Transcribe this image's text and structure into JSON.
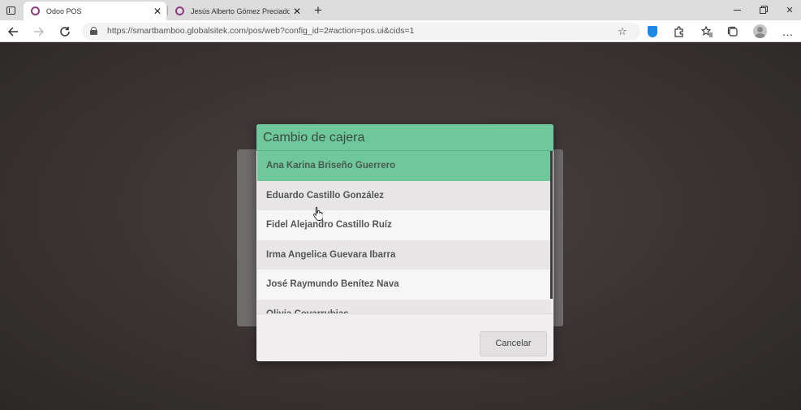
{
  "browser": {
    "tabs": [
      {
        "title": "Odoo POS",
        "active": true
      },
      {
        "title": "Jesús Alberto Gómez Preciado -",
        "active": false
      }
    ],
    "url": "https://smartbamboo.globalsitek.com/pos/web?config_id=2#action=pos.ui&cids=1",
    "new_tab_symbol": "+",
    "close_symbol": "✕",
    "icons": {
      "back": "arrow-left-icon",
      "forward": "arrow-right-icon",
      "reload": "reload-icon",
      "more": "…"
    }
  },
  "popup": {
    "title": "Cambio de cajera",
    "cashiers": [
      "Ana Karina Briseño Guerrero",
      "Eduardo Castillo González",
      "Fidel Alejandro Castillo Ruíz",
      "Irma Angelica Guevara Ibarra",
      "José Raymundo Benítez Nava",
      "Olivia Covarrubias"
    ],
    "selected_index": 0,
    "cancel_label": "Cancelar"
  },
  "colors": {
    "accent_green": "#6ec89b",
    "odoo_purple": "#8f3a86",
    "edge_shield_blue": "#1e88e5"
  }
}
